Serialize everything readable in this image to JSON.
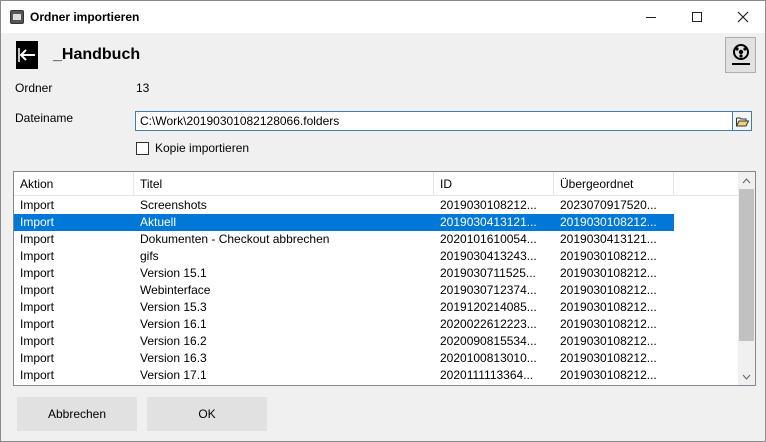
{
  "window": {
    "title": "Ordner importieren"
  },
  "header": {
    "title": "_Handbuch"
  },
  "form": {
    "ordner_label": "Ordner",
    "ordner_value": "13",
    "dateiname_label": "Dateiname",
    "dateiname_value": "C:\\Work\\20190301082128066.folders",
    "kopie_label": "Kopie importieren",
    "kopie_checked": false
  },
  "grid": {
    "columns": [
      "Aktion",
      "Titel",
      "ID",
      "Übergeordnet"
    ],
    "selected_index": 1,
    "rows": [
      [
        "Import",
        "Screenshots",
        "2019030108212...",
        "2023070917520..."
      ],
      [
        "Import",
        "Aktuell",
        "2019030413121...",
        "2019030108212..."
      ],
      [
        "Import",
        "Dokumenten - Checkout abbrechen",
        "2020101610054...",
        "2019030413121..."
      ],
      [
        "Import",
        "gifs",
        "2019030413243...",
        "2019030108212..."
      ],
      [
        "Import",
        "Version 15.1",
        "2019030711525...",
        "2019030108212..."
      ],
      [
        "Import",
        "Webinterface",
        "2019030712374...",
        "2019030108212..."
      ],
      [
        "Import",
        "Version 15.3",
        "2019120214085...",
        "2019030108212..."
      ],
      [
        "Import",
        "Version 16.1",
        "2020022612223...",
        "2019030108212..."
      ],
      [
        "Import",
        "Version 16.2",
        "2020090815534...",
        "2019030108212..."
      ],
      [
        "Import",
        "Version 16.3",
        "2020100813010...",
        "2019030108212..."
      ],
      [
        "Import",
        "Version 17.1",
        "2020111113364...",
        "2019030108212..."
      ]
    ]
  },
  "buttons": {
    "cancel": "Abbrechen",
    "ok": "OK"
  },
  "colors": {
    "selection": "#0078d7",
    "accent_border": "#3c7fb1"
  }
}
